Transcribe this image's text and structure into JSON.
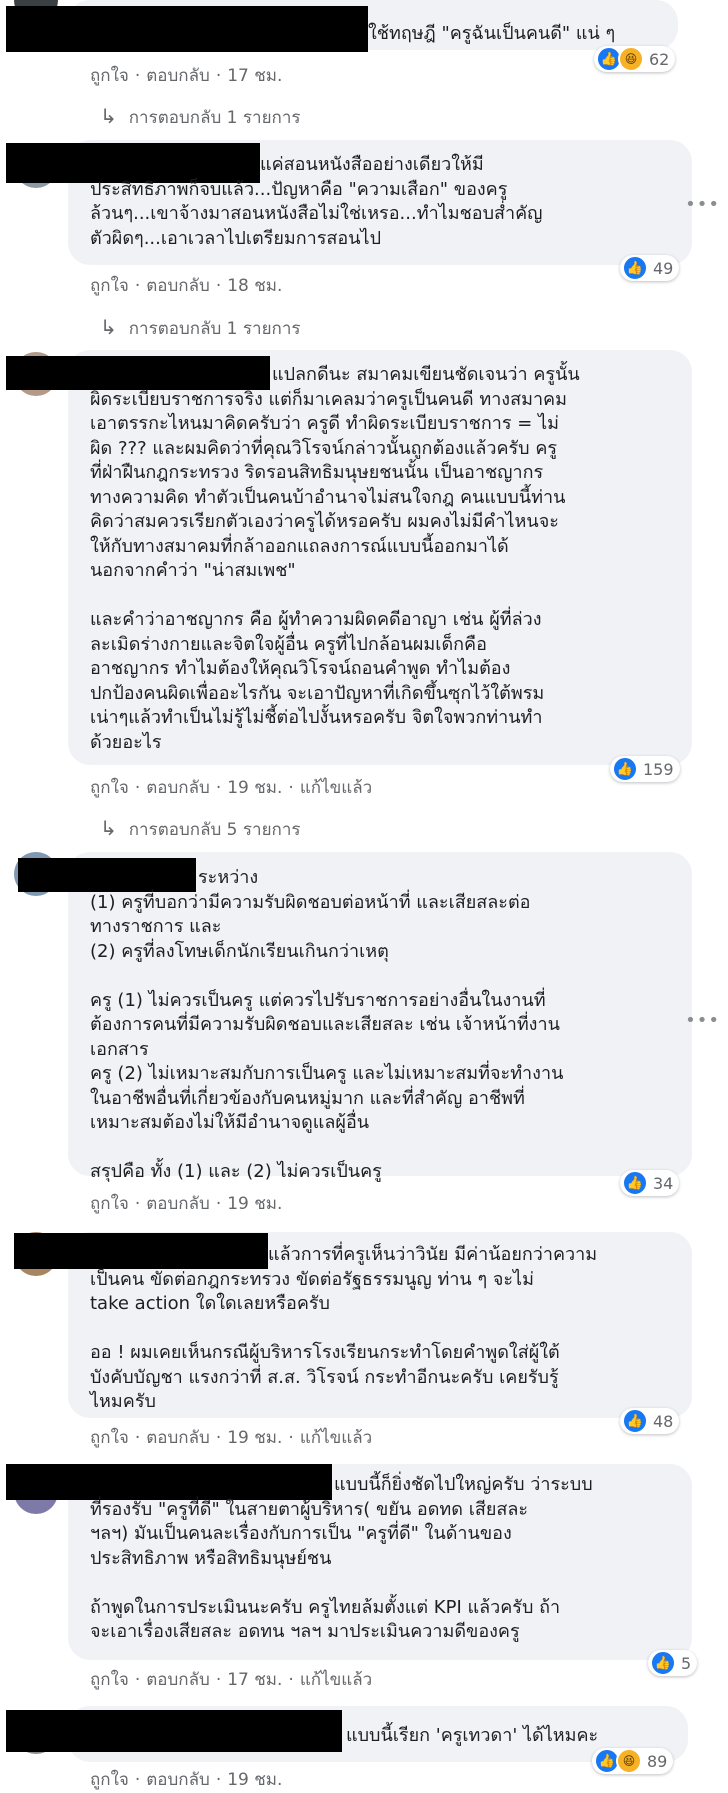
{
  "colors": {
    "like": "#1877f2",
    "haha": "#f7b125",
    "bubble": "#f0f2f5",
    "meta": "#65676b"
  },
  "labels": {
    "like": "ถูกใจ",
    "reply": "ตอบกลับ",
    "edited": "แก้ไขแล้ว"
  },
  "comments": [
    {
      "text": "ใช้ทฤษฎี \"ครูฉันเป็นคนดี\" แน่ ๆ",
      "time": "17 ชม.",
      "reactions": "62",
      "reaction_icons": [
        "like-icon",
        "haha-icon"
      ],
      "replies": "การตอบกลับ 1 รายการ"
    },
    {
      "text": "แค่สอนหนังสืออย่างเดียวให้มี\nประสิทธิภาพก็จบแล้ว...ปัญหาคือ \"ความเสือก\" ของครู\nล้วนๆ...เขาจ้างมาสอนหนังสือไม่ใช่เหรอ...ทำไมชอบส่ำคัญ\nตัวผิดๆ...เอาเวลาไปเตรียมการสอนไป",
      "time": "18 ชม.",
      "reactions": "49",
      "reaction_icons": [
        "like-icon"
      ],
      "replies": "การตอบกลับ 1 รายการ"
    },
    {
      "text": "แปลกดีนะ สมาคมเขียนชัดเจนว่า ครูนั้น\nผิดระเบียบราชการจริง แต่ก็มาเคลมว่าครูเป็นคนดี ทางสมาคม\nเอาตรรกะไหนมาคิดครับว่า ครูดี ทำผิดระเบียบราชการ = ไม่\nผิด ??? และผมคิดว่าที่คุณวิโรจน์กล่าวนั้นถูกต้องแล้วครับ ครู\nที่ฝ่าฝืนกฎกระทรวง ริดรอนสิทธิมนุษยชนนั้น เป็นอาชญากร\nทางความคิด ทำตัวเป็นคนบ้าอำนาจไม่สนใจกฎ คนแบบนี้ท่าน\nคิดว่าสมควรเรียกตัวเองว่าครูได้หรอครับ ผมคงไม่มีคำไหนจะ\nให้กับทางสมาคมที่กล้าออกแถลงการณ์แบบนี้ออกมาได้\nนอกจากคำว่า \"น่าสมเพช\"\n\nและคำว่าอาชญากร คือ ผู้ทำความผิดคดีอาญา เช่น ผู้ที่ล่วง\nละเมิดร่างกายและจิตใจผู้อื่น ครูที่ไปกล้อนผมเด็กคือ\nอาชญากร ทำไมต้องให้คุณวิโรจน์ถอนคำพูด ทำไมต้อง\nปกป้องคนผิดเพื่ออะไรกัน จะเอาปัญหาที่เกิดขึ้นซุกไว้ใต้พรม\nเน่าๆแล้วทำเป็นไม่รู้ไม่ชี้ต่อไปงั้นหรอครับ จิตใจพวกท่านทำ\nด้วยอะไร",
      "time": "19 ชม.",
      "edited": true,
      "reactions": "159",
      "reaction_icons": [
        "like-icon"
      ],
      "replies": "การตอบกลับ 5 รายการ"
    },
    {
      "text": "ระหว่าง\n(1) ครูที่บอกว่ามีความรับผิดชอบต่อหน้าที่ และเสียสละต่อ\nทางราชการ และ\n(2) ครูที่ลงโทษเด็กนักเรียนเกินกว่าเหตุ\n\nครู (1) ไม่ควรเป็นครู แต่ควรไปรับราชการอย่างอื่นในงานที่\nต้องการคนที่มีความรับผิดชอบและเสียสละ เช่น เจ้าหน้าที่งาน\nเอกสาร\nครู (2) ไม่เหมาะสมกับการเป็นครู และไม่เหมาะสมที่จะทำงาน\nในอาชีพอื่นที่เกี่ยวข้องกับคนหมู่มาก และที่สำคัญ อาชีพที่\nเหมาะสมต้องไม่ให้มีอำนาจดูแลผู้อื่น\n\nสรุปคือ ทั้ง (1) และ (2) ไม่ควรเป็นครู",
      "time": "19 ชม.",
      "reactions": "34",
      "reaction_icons": [
        "like-icon"
      ]
    },
    {
      "text": "แล้วการที่ครูเห็นว่าวินัย มีค่าน้อยกว่าความ\nเป็นคน ขัดต่อกฎกระทรวง ขัดต่อรัฐธรรมนูญ ท่าน ๆ จะไม่\ntake action ใดใดเลยหรือครับ\n\nออ ! ผมเคยเห็นกรณีผู้บริหารโรงเรียนกระทำโดยคำพูดใส่ผู้ใต้\nบังคับบัญชา แรงกว่าที่ ส.ส. วิโรจน์ กระทำอีกนะครับ เคยรับรู้\nไหมครับ",
      "time": "19 ชม.",
      "edited": true,
      "reactions": "48",
      "reaction_icons": [
        "like-icon"
      ]
    },
    {
      "text": "แบบนี้ก็ยิ่งชัดไปใหญ่ครับ ว่าระบบ\nที่รองรับ \"ครูที่ดี\" ในสายตาผู้บริหาร( ขยัน อดทด เสียสละ\nฯลฯ) มันเป็นคนละเรื่องกับการเป็น \"ครูที่ดี\" ในด้านของ\nประสิทธิภาพ หรือสิทธิมนุษย์ชน\n\nถ้าพูดในการประเมินนะครับ ครูไทยล้มตั้งแต่ KPI แล้วครับ ถ้า\nจะเอาเรื่องเสียสละ อดทน ฯลฯ มาประเมินความดีของครู",
      "time": "17 ชม.",
      "edited": true,
      "reactions": "5",
      "reaction_icons": [
        "like-icon"
      ]
    },
    {
      "text": "แบบนี้เรียก 'ครูเทวดา' ได้ไหมคะ",
      "time": "19 ชม.",
      "reactions": "89",
      "reaction_icons": [
        "like-icon",
        "haha-icon"
      ]
    }
  ]
}
